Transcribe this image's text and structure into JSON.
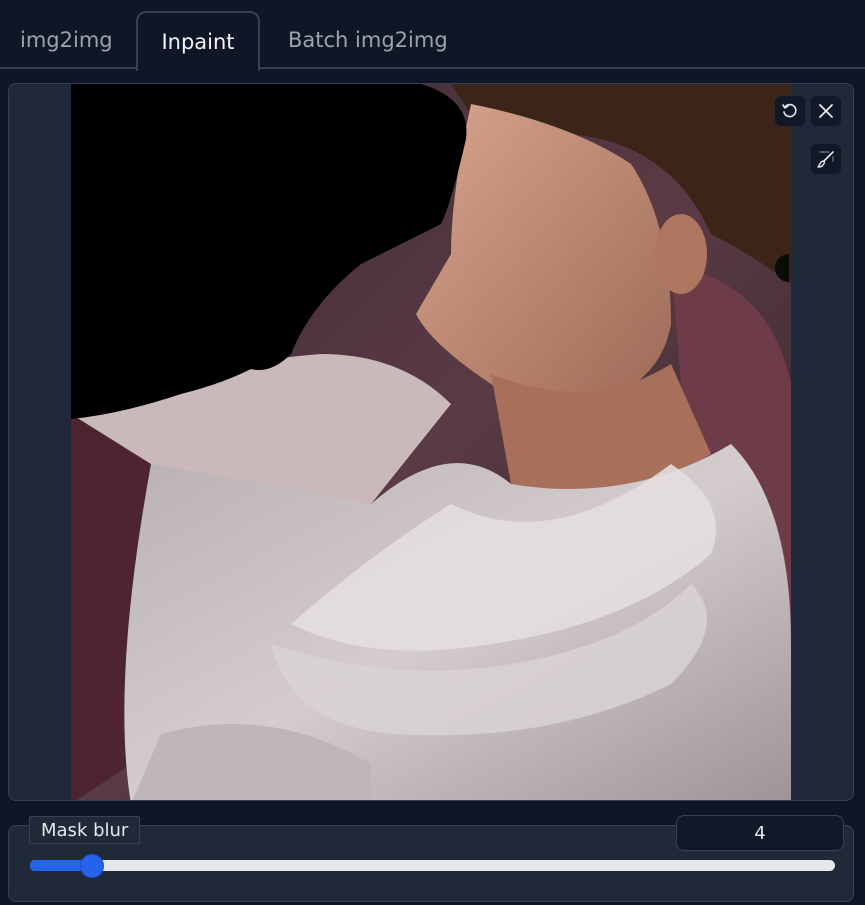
{
  "tabs": [
    {
      "label": "img2img",
      "active": false
    },
    {
      "label": "Inpaint",
      "active": true
    },
    {
      "label": "Batch img2img",
      "active": false
    }
  ],
  "editor": {
    "image_description": "inpaint canvas",
    "toolbar": {
      "undo_icon": "undo-icon",
      "close_icon": "close-icon",
      "brush_icon": "brush-icon"
    }
  },
  "mask_blur": {
    "label": "Mask blur",
    "value": "4",
    "min": 0,
    "max": 64,
    "accent_color": "#2563eb"
  }
}
